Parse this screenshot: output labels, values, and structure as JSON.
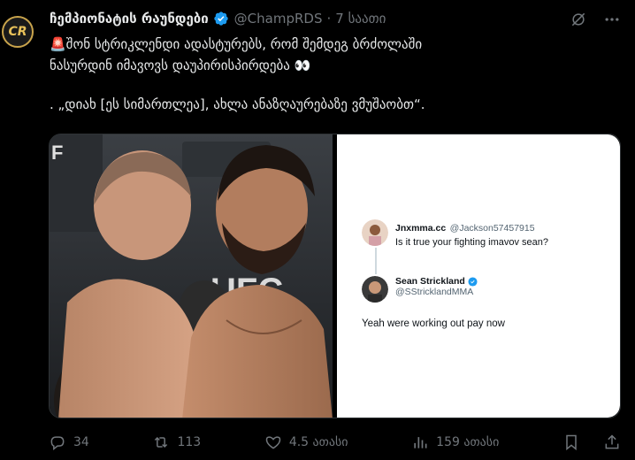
{
  "post": {
    "author_name": "ჩემპიონატის რაუნდები",
    "handle": "@ChampRDS",
    "dot": "·",
    "time": "7 საათი",
    "avatar_text": "CR",
    "text_line1": "🚨შონ სტრიკლენდი ადასტურებს, რომ შემდეგ ბრძოლაში",
    "text_line2": "ნასურდინ იმავოვს დაუპირისპირდება 👀",
    "text_line3": ". „დიახ [ეს სიმართლეა], ახლა ანაზღაურებაზე ვმუშაობთ“."
  },
  "embedded_tweet": {
    "question_name": "Jnxmma.cc",
    "question_handle": "@Jackson57457915",
    "question_text": "Is it true your fighting imavov sean?",
    "reply_name": "Sean Strickland",
    "reply_handle": "@SStricklandMMA",
    "reply_text": "Yeah were working out pay now"
  },
  "photo_banner": {
    "text_ufc": "UFC",
    "text_f": "F"
  },
  "actions": {
    "replies": "34",
    "reposts": "113",
    "likes": "4.5 ათასი",
    "views": "159 ათასი"
  },
  "colors": {
    "background": "#000000",
    "text": "#e7e9ea",
    "muted": "#71767b",
    "verified": "#1d9bf0"
  }
}
